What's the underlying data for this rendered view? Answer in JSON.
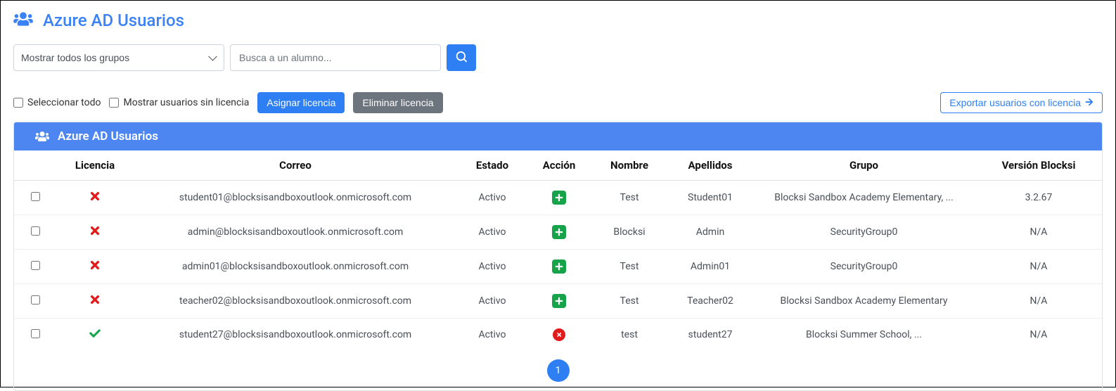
{
  "header": {
    "title": "Azure AD Usuarios"
  },
  "toolbar": {
    "group_select": "Mostrar todos los grupos",
    "search_placeholder": "Busca a un alumno..."
  },
  "actions": {
    "select_all_label": "Seleccionar todo",
    "show_unlicensed_label": "Mostrar usuarios sin licencia",
    "assign_license": "Asignar licencia",
    "remove_license": "Eliminar licencia",
    "export_licensed": "Exportar usuarios con licencia"
  },
  "card": {
    "title": "Azure AD Usuarios"
  },
  "table": {
    "headers": {
      "licencia": "Licencia",
      "correo": "Correo",
      "estado": "Estado",
      "accion": "Acción",
      "nombre": "Nombre",
      "apellidos": "Apellidos",
      "grupo": "Grupo",
      "version": "Versión Blocksi"
    },
    "rows": [
      {
        "licensed": false,
        "correo": "student01@blocksisandboxoutlook.onmicrosoft.com",
        "estado": "Activo",
        "action": "add",
        "nombre": "Test",
        "apellidos": "Student01",
        "grupo": "Blocksi Sandbox Academy Elementary, ...",
        "version": "3.2.67"
      },
      {
        "licensed": false,
        "correo": "admin@blocksisandboxoutlook.onmicrosoft.com",
        "estado": "Activo",
        "action": "add",
        "nombre": "Blocksi",
        "apellidos": "Admin",
        "grupo": "SecurityGroup0",
        "version": "N/A"
      },
      {
        "licensed": false,
        "correo": "admin01@blocksisandboxoutlook.onmicrosoft.com",
        "estado": "Activo",
        "action": "add",
        "nombre": "Test",
        "apellidos": "Admin01",
        "grupo": "SecurityGroup0",
        "version": "N/A"
      },
      {
        "licensed": false,
        "correo": "teacher02@blocksisandboxoutlook.onmicrosoft.com",
        "estado": "Activo",
        "action": "add",
        "nombre": "Test",
        "apellidos": "Teacher02",
        "grupo": "Blocksi Sandbox Academy Elementary",
        "version": "N/A"
      },
      {
        "licensed": true,
        "correo": "student27@blocksisandboxoutlook.onmicrosoft.com",
        "estado": "Activo",
        "action": "remove",
        "nombre": "test",
        "apellidos": "student27",
        "grupo": "Blocksi Summer School, ...",
        "version": "N/A"
      }
    ]
  },
  "pagination": {
    "pages": [
      "1"
    ]
  }
}
